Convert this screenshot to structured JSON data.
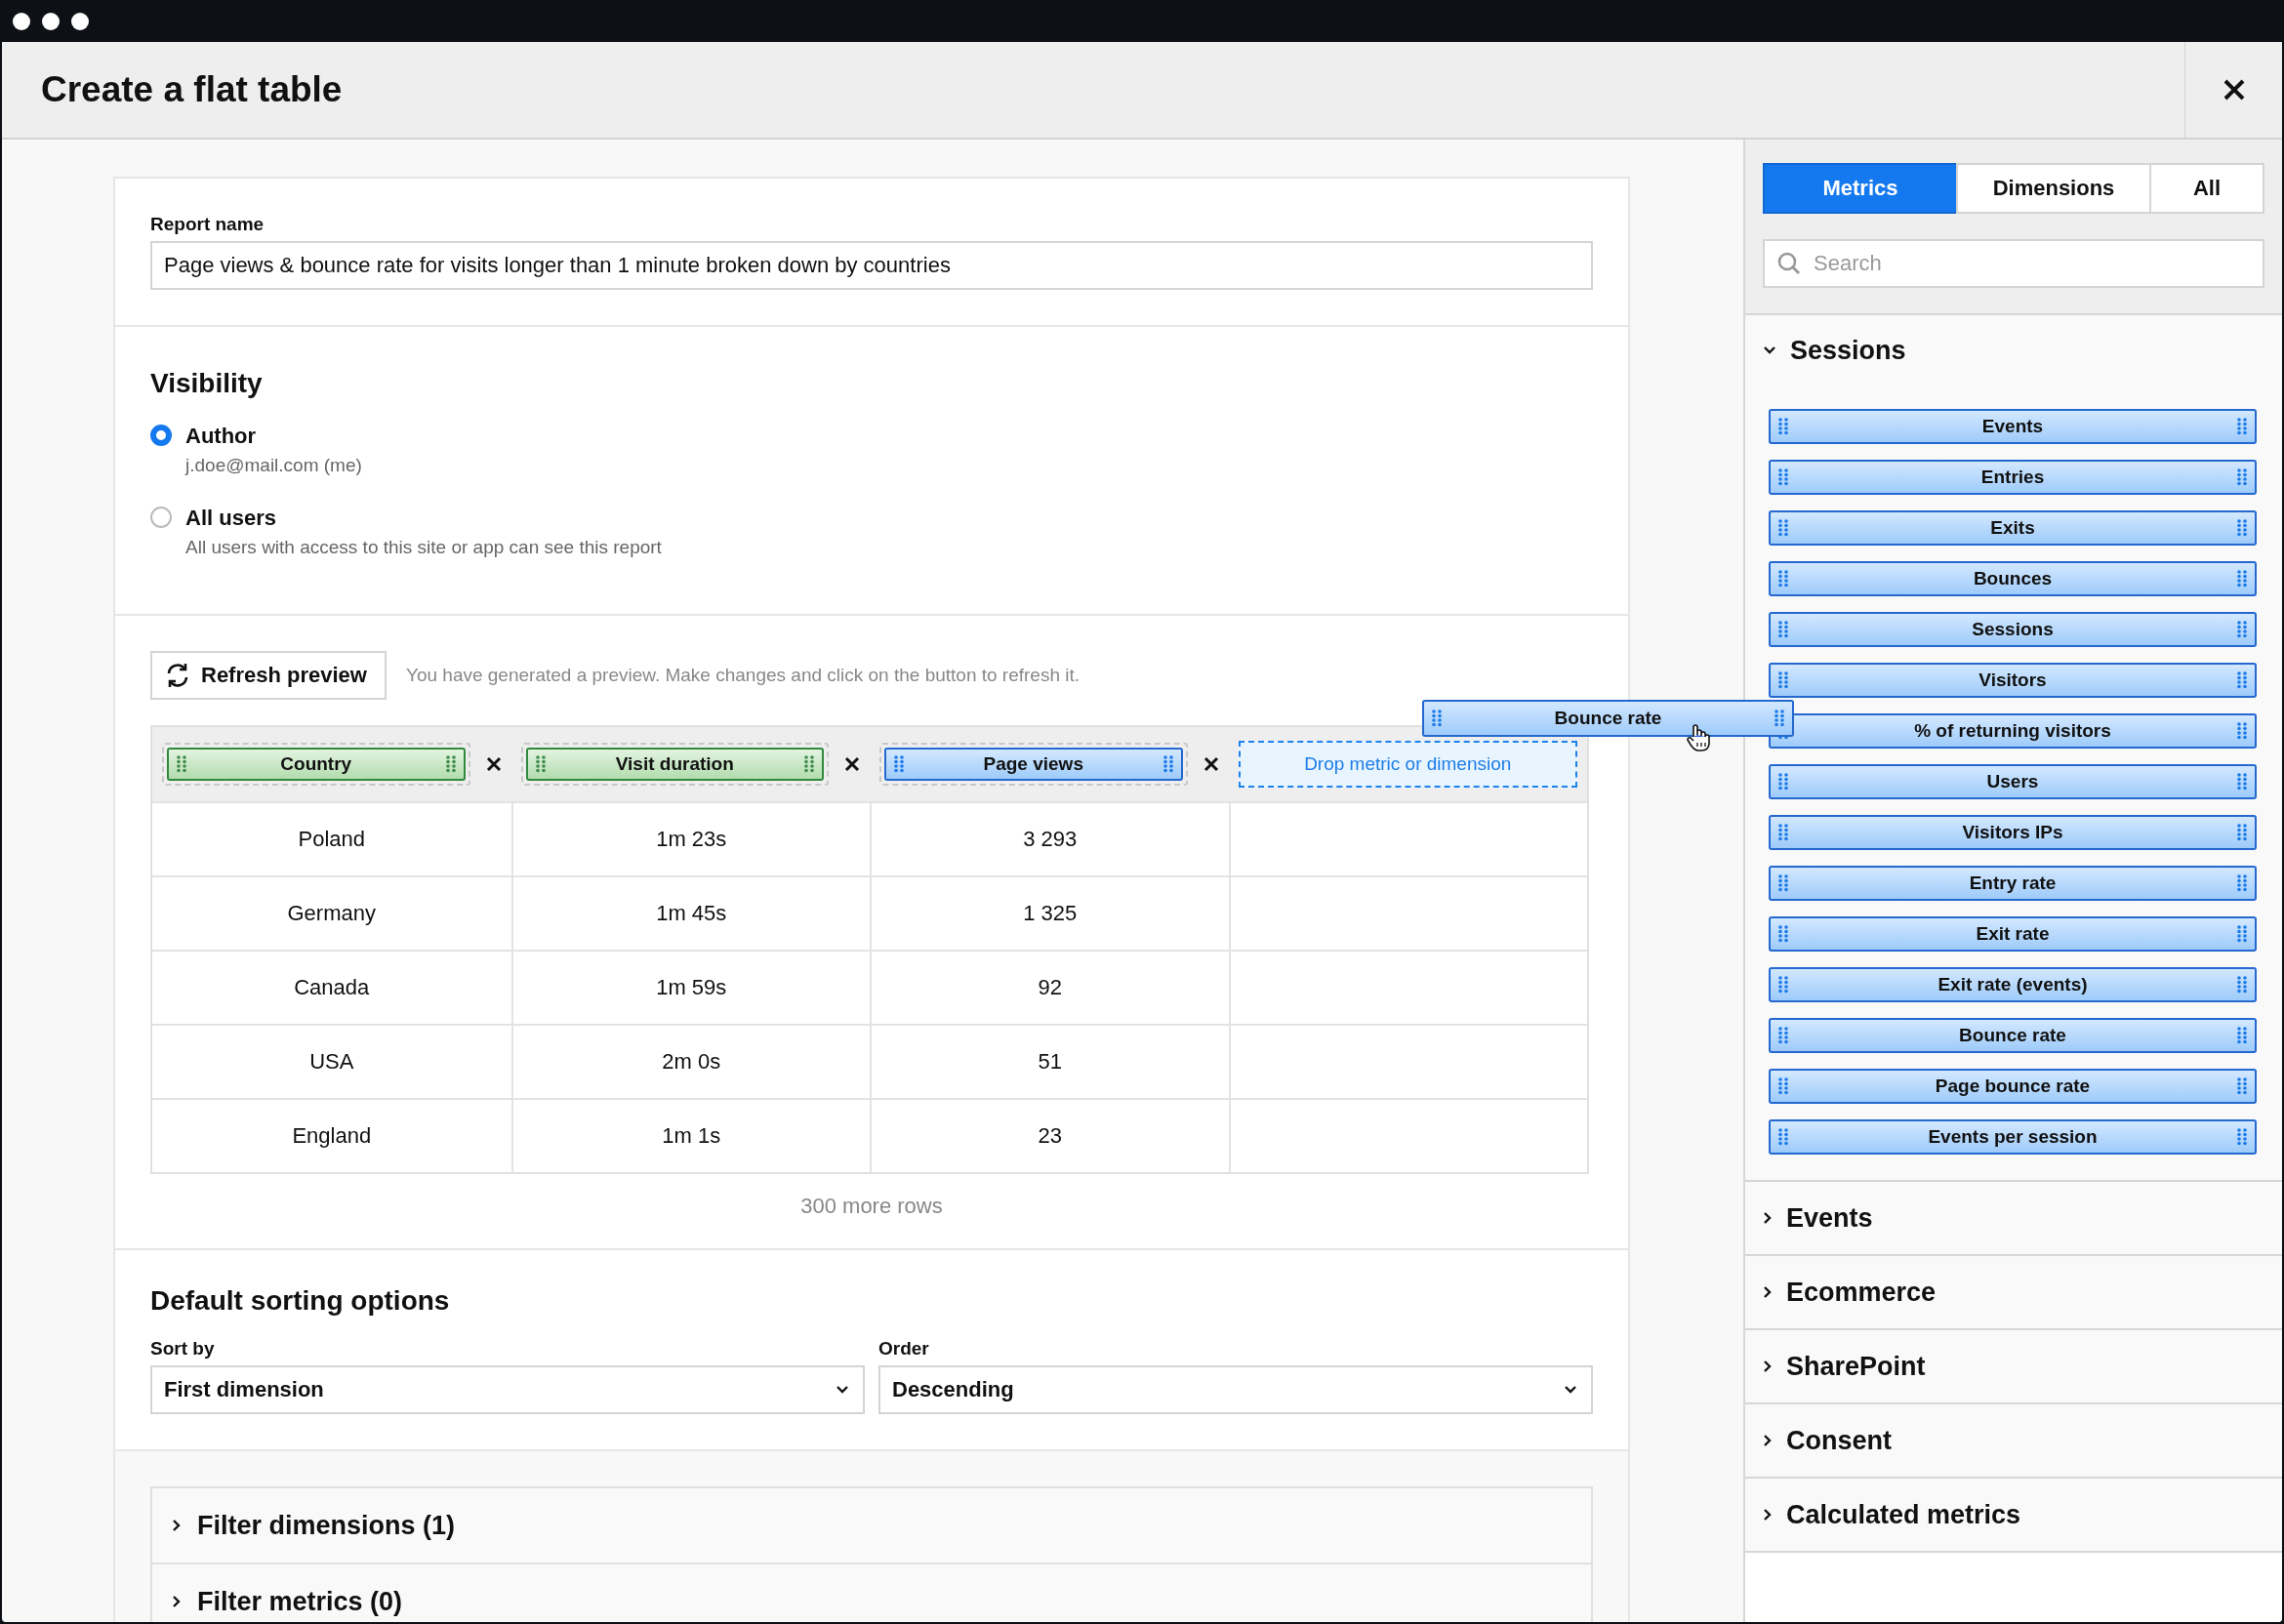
{
  "window": {
    "title": "Create a flat table"
  },
  "report_name": {
    "label": "Report name",
    "value": "Page views & bounce rate for visits longer than 1 minute broken down by countries"
  },
  "visibility": {
    "title": "Visibility",
    "options": [
      {
        "label": "Author",
        "description": "j.doe@mail.com (me)",
        "selected": true
      },
      {
        "label": "All users",
        "description": "All users with access to this site or app can see this report",
        "selected": false
      }
    ]
  },
  "preview": {
    "button": "Refresh preview",
    "hint": "You have generated a preview. Make changes and click on the button to refresh it.",
    "columns": [
      {
        "label": "Country",
        "kind": "dimension"
      },
      {
        "label": "Visit duration",
        "kind": "dimension"
      },
      {
        "label": "Page views",
        "kind": "metric"
      }
    ],
    "drop_placeholder": "Drop metric or dimension",
    "rows": [
      [
        "Poland",
        "1m 23s",
        "3 293"
      ],
      [
        "Germany",
        "1m 45s",
        "1 325"
      ],
      [
        "Canada",
        "1m 59s",
        "92"
      ],
      [
        "USA",
        "2m 0s",
        "51"
      ],
      [
        "England",
        "1m 1s",
        "23"
      ]
    ],
    "more_rows": "300 more rows"
  },
  "dragged_item": {
    "label": "Bounce rate",
    "kind": "metric"
  },
  "sorting": {
    "title": "Default sorting options",
    "fields": [
      {
        "label": "Sort by",
        "value": "First dimension"
      },
      {
        "label": "Order",
        "value": "Descending"
      }
    ]
  },
  "filters": [
    {
      "label": "Filter dimensions (1)",
      "expanded": false
    },
    {
      "label": "Filter metrics (0)",
      "expanded": false
    }
  ],
  "sidebar": {
    "tabs": [
      {
        "label": "Metrics",
        "selected": true
      },
      {
        "label": "Dimensions",
        "selected": false
      },
      {
        "label": "All",
        "selected": false
      }
    ],
    "search": {
      "placeholder": "Search"
    },
    "groups": [
      {
        "title": "Sessions",
        "expanded": true,
        "items": [
          "Events",
          "Entries",
          "Exits",
          "Bounces",
          "Sessions",
          "Visitors",
          "% of returning visitors",
          "Users",
          "Visitors IPs",
          "Entry rate",
          "Exit rate",
          "Exit rate (events)",
          "Bounce rate",
          "Page bounce rate",
          "Events per session"
        ]
      },
      {
        "title": "Events",
        "expanded": false
      },
      {
        "title": "Ecommerce",
        "expanded": false
      },
      {
        "title": "SharePoint",
        "expanded": false
      },
      {
        "title": "Consent",
        "expanded": false
      },
      {
        "title": "Calculated metrics",
        "expanded": false
      }
    ]
  }
}
